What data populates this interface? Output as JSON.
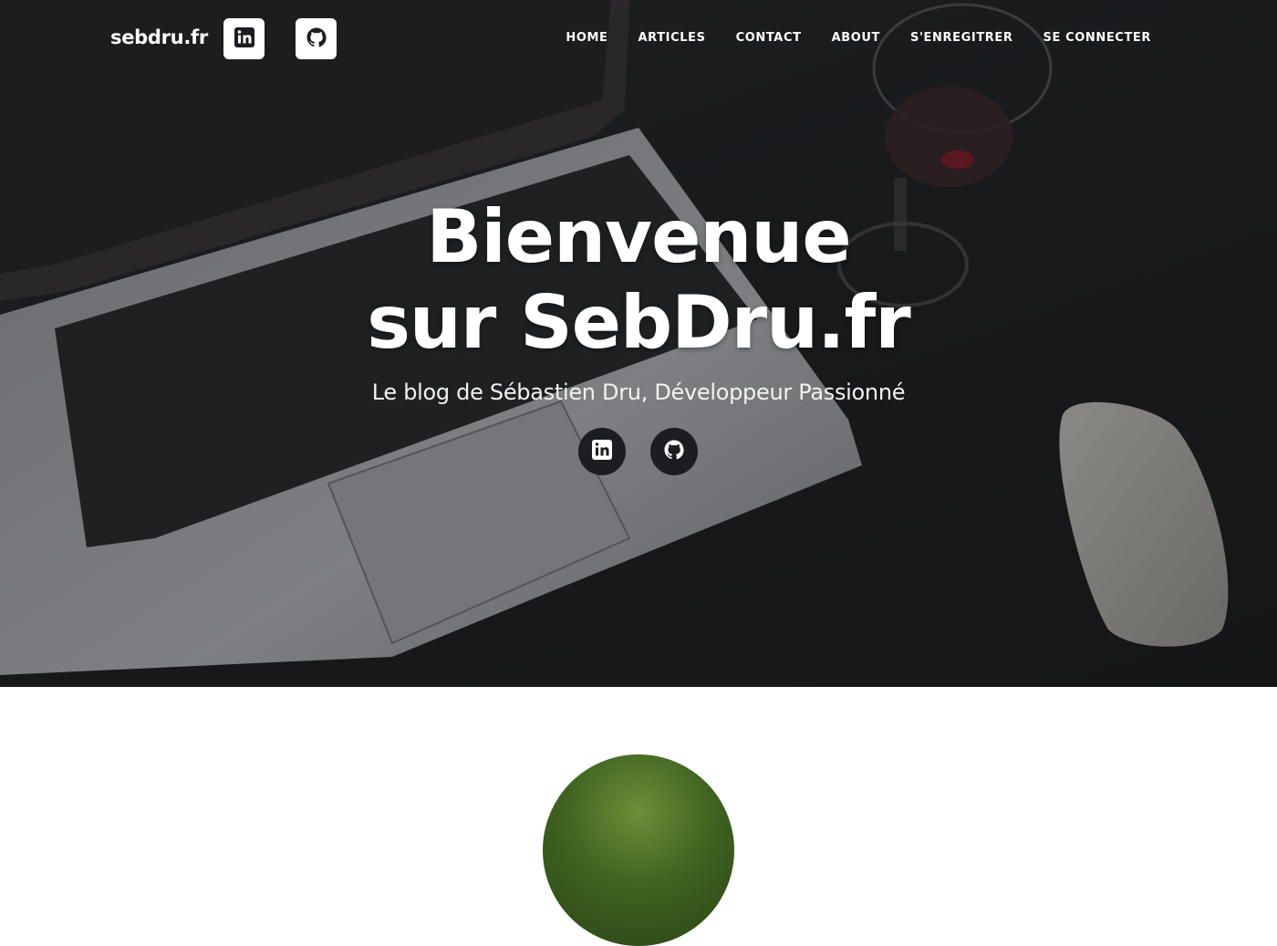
{
  "nav": {
    "brand": "sebdru.fr",
    "social": [
      {
        "icon": "linkedin-icon"
      },
      {
        "icon": "github-icon"
      }
    ],
    "links": [
      {
        "label": "HOME"
      },
      {
        "label": "ARTICLES"
      },
      {
        "label": "CONTACT"
      },
      {
        "label": "ABOUT"
      },
      {
        "label": "S'ENREGITRER"
      },
      {
        "label": "SE CONNECTER"
      }
    ]
  },
  "hero": {
    "title_line1": "Bienvenue",
    "title_line2": "sur SebDru.fr",
    "subtitle": "Le blog de Sébastien Dru, Développeur Passionné",
    "social": [
      {
        "icon": "linkedin-icon"
      },
      {
        "icon": "github-icon"
      }
    ]
  },
  "colors": {
    "hero_dark": "#1c1d20",
    "nav_icon_bg": "#ffffff",
    "text": "#ffffff"
  }
}
